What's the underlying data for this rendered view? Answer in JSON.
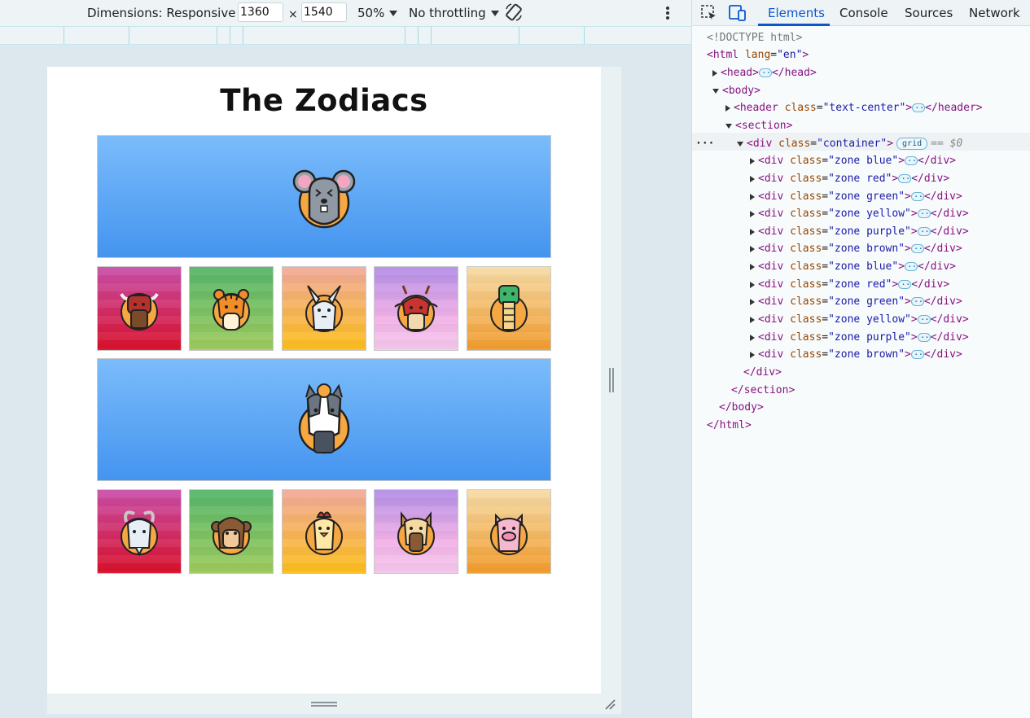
{
  "toolbar": {
    "dimensions_label": "Dimensions: Responsive",
    "width_value": "1360",
    "times": "×",
    "height_value": "1540",
    "zoom": "50%",
    "throttling": "No throttling"
  },
  "page": {
    "title": "The Zodiacs",
    "zones": [
      {
        "color": "blue",
        "animal": "rat",
        "big": true
      },
      {
        "color": "red",
        "animal": "ox"
      },
      {
        "color": "green",
        "animal": "tiger"
      },
      {
        "color": "yellow",
        "animal": "rabbit"
      },
      {
        "color": "purple",
        "animal": "dragon"
      },
      {
        "color": "brown",
        "animal": "snake"
      },
      {
        "color": "blue",
        "animal": "horse",
        "big": true
      },
      {
        "color": "red",
        "animal": "goat"
      },
      {
        "color": "green",
        "animal": "monkey"
      },
      {
        "color": "yellow",
        "animal": "rooster"
      },
      {
        "color": "purple",
        "animal": "dog"
      },
      {
        "color": "brown",
        "animal": "pig"
      }
    ]
  },
  "devtools": {
    "tabs": [
      "Elements",
      "Console",
      "Sources",
      "Network"
    ],
    "active_tab": "Elements",
    "dom": {
      "doctype": "<!DOCTYPE html>",
      "html_open_tag": "<html",
      "html_attr": "lang",
      "html_val": "\"en\"",
      "head": "head",
      "body": "body",
      "header": "header",
      "header_attr": "class",
      "header_val": "\"text-center\"",
      "section": "section",
      "container_tag": "div",
      "container_attr": "class",
      "container_val": "\"container\"",
      "grid_badge": "grid",
      "selected_marker": "== $0",
      "zone_tag": "div",
      "zone_classes": [
        "\"zone blue\"",
        "\"zone red\"",
        "\"zone green\"",
        "\"zone yellow\"",
        "\"zone purple\"",
        "\"zone brown\"",
        "\"zone blue\"",
        "\"zone red\"",
        "\"zone green\"",
        "\"zone yellow\"",
        "\"zone purple\"",
        "\"zone brown\""
      ],
      "close_div": "</div>",
      "close_section": "</section>",
      "close_body": "</body>",
      "close_html": "</html>"
    }
  },
  "colors": {
    "accent": "#0b57d0",
    "tag": "#881280",
    "attr": "#994500",
    "value": "#1a1aa6"
  }
}
